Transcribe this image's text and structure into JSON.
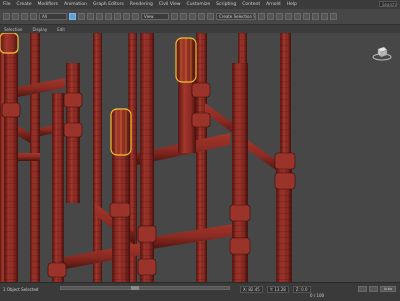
{
  "menu": {
    "items": [
      "File",
      "Create",
      "Modifiers",
      "Animation",
      "Graph Editors",
      "Rendering",
      "Civil View",
      "Customize",
      "Scripting",
      "Content",
      "Arnold",
      "Help"
    ],
    "search_placeholder": "Search"
  },
  "toolbar": {
    "selection_set": "Create Selection Set"
  },
  "subbar": {
    "labels": [
      "Selection",
      "Display",
      "Edit"
    ]
  },
  "viewport": {
    "background_color": "#474747",
    "pipe_color": "#8b2b23",
    "selection_color": "#f2c230"
  },
  "statusbar": {
    "left_text": "1 Object Selected",
    "coord_x": "X: 82.45",
    "coord_y": "Y: 13.28",
    "coord_z": "Z: 0.0",
    "frame_label": "0 / 100",
    "set_key_label": "Auto"
  },
  "icons": {
    "select": "select-icon",
    "move": "move-icon",
    "rotate": "rotate-icon",
    "scale": "scale-icon",
    "snap": "snap-icon",
    "viewcube": "viewcube-icon",
    "search": "search-icon",
    "play": "play-icon"
  }
}
